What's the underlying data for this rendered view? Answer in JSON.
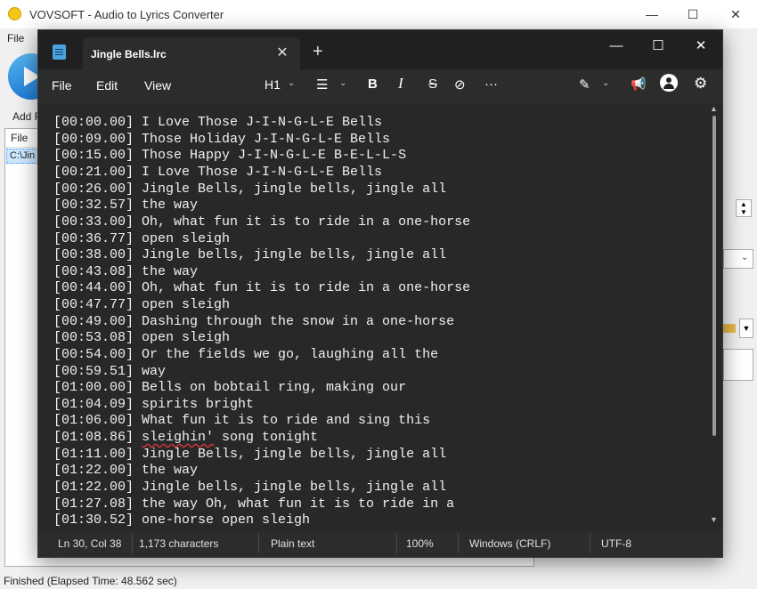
{
  "background_app": {
    "title": "VOVSOFT - Audio to Lyrics Converter",
    "menu_file": "File",
    "add_label": "Add F",
    "list_header": "File",
    "list_row": "C:\\Jin",
    "status": "Finished (Elapsed Time: 48.562 sec)",
    "minimize": "—",
    "maximize": "☐",
    "close": "✕"
  },
  "notepad": {
    "tab_title": "Jingle Bells.lrc",
    "tab_close": "✕",
    "new_tab": "+",
    "win_minimize": "—",
    "win_maximize": "☐",
    "win_close": "✕",
    "menu": [
      "File",
      "Edit",
      "View"
    ],
    "toolbar": {
      "heading": "H1",
      "list_icon": "☰",
      "bold": "B",
      "italic": "I",
      "strike": "S",
      "link": "⊘",
      "more": "···",
      "copilot_icon": "✎",
      "feedback_icon": "📢",
      "account_icon": "●",
      "settings_icon": "⚙"
    },
    "lines": [
      "[00:00.00] I Love Those J-I-N-G-L-E Bells",
      "[00:09.00] Those Holiday J-I-N-G-L-E Bells",
      "[00:15.00] Those Happy J-I-N-G-L-E B-E-L-L-S",
      "[00:21.00] I Love Those J-I-N-G-L-E Bells",
      "[00:26.00] Jingle Bells, jingle bells, jingle all",
      "[00:32.57] the way",
      "[00:33.00] Oh, what fun it is to ride in a one-horse",
      "[00:36.77] open sleigh",
      "[00:38.00] Jingle bells, jingle bells, jingle all",
      "[00:43.08] the way",
      "[00:44.00] Oh, what fun it is to ride in a one-horse",
      "[00:47.77] open sleigh",
      "[00:49.00] Dashing through the snow in a one-horse",
      "[00:53.08] open sleigh",
      "[00:54.00] Or the fields we go, laughing all the",
      "[00:59.51] way",
      "[01:00.00] Bells on bobtail ring, making our",
      "[01:04.09] spirits bright",
      "[01:06.00] What fun it is to ride and sing this",
      "[01:08.86] ",
      "[01:11.00] Jingle Bells, jingle bells, jingle all",
      "[01:22.00] the way",
      "[01:22.00] Jingle bells, jingle bells, jingle all",
      "[01:27.08] the way Oh, what fun it is to ride in a",
      "[01:30.52] one-horse open sleigh"
    ],
    "line20_word": "sleighin'",
    "line20_rest": " song tonight",
    "status": {
      "position": "Ln 30, Col 38",
      "chars": "1,173 characters",
      "format": "Plain text",
      "zoom": "100%",
      "line_ending": "Windows (CRLF)",
      "encoding": "UTF-8"
    }
  }
}
